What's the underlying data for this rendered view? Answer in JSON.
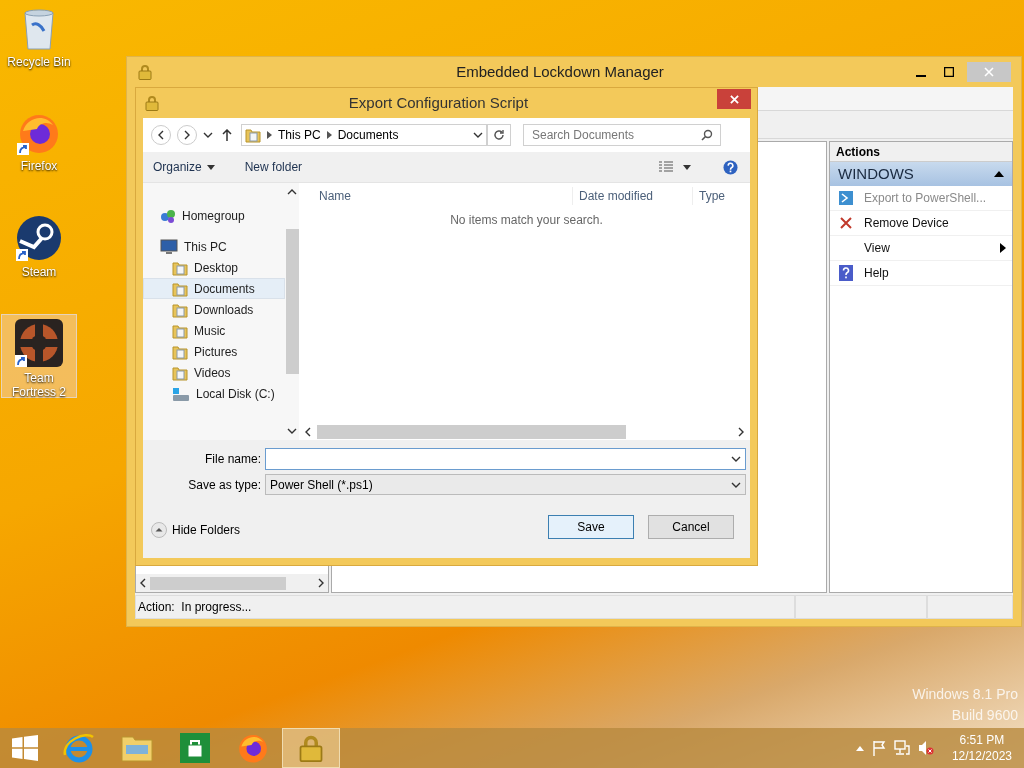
{
  "desktop_icons": [
    {
      "label": "Recycle Bin",
      "kind": "recycle",
      "shortcut": false,
      "selected": false
    },
    {
      "label": "Firefox",
      "kind": "firefox",
      "shortcut": true,
      "selected": false
    },
    {
      "label": "Steam",
      "kind": "steam",
      "shortcut": true,
      "selected": false
    },
    {
      "label": "Team Fortress 2",
      "kind": "game",
      "shortcut": true,
      "selected": true
    }
  ],
  "main_window": {
    "title": "Embedded Lockdown Manager",
    "actions_pane": {
      "header": "Actions",
      "group": {
        "label": "WINDOWS",
        "expanded": true
      },
      "items": [
        {
          "label": "Export to PowerShell...",
          "kind": "script",
          "disabled": true,
          "submenu": false
        },
        {
          "label": "Remove Device",
          "kind": "remove",
          "disabled": false,
          "submenu": false
        },
        {
          "label": "View",
          "kind": "plain",
          "disabled": false,
          "submenu": true
        },
        {
          "label": "Help",
          "kind": "help",
          "disabled": false,
          "submenu": false
        }
      ]
    },
    "status_bar": "Action:  In progress..."
  },
  "dialog": {
    "title": "Export Configuration Script",
    "breadcrumb": [
      "This PC",
      "Documents"
    ],
    "search": {
      "placeholder": "Search Documents"
    },
    "toolbar": {
      "organize": "Organize",
      "new_folder": "New folder"
    },
    "nav_pane": [
      {
        "label": "Homegroup",
        "kind": "group",
        "selected": false
      },
      {
        "label": "This PC",
        "kind": "computer",
        "selected": false,
        "children": [
          {
            "label": "Desktop",
            "kind": "folder",
            "selected": false
          },
          {
            "label": "Documents",
            "kind": "folder",
            "selected": true
          },
          {
            "label": "Downloads",
            "kind": "folder",
            "selected": false
          },
          {
            "label": "Music",
            "kind": "folder",
            "selected": false
          },
          {
            "label": "Pictures",
            "kind": "folder",
            "selected": false
          },
          {
            "label": "Videos",
            "kind": "folder",
            "selected": false
          },
          {
            "label": "Local Disk (C:)",
            "kind": "drive",
            "selected": false
          }
        ]
      }
    ],
    "columns": [
      "Name",
      "Date modified",
      "Type"
    ],
    "empty_message": "No items match your search.",
    "file_name": {
      "label": "File name:"
    },
    "save_as_type": {
      "label": "Save as type:",
      "value": "Power Shell (*.ps1)"
    },
    "hide_folders": "Hide Folders",
    "buttons": [
      {
        "label": "Save",
        "default": true
      },
      {
        "label": "Cancel",
        "default": false
      }
    ]
  },
  "watermark": [
    "Windows 8.1 Pro",
    "Build 9600"
  ],
  "taskbar": {
    "apps": [
      {
        "kind": "browser",
        "selected": false
      },
      {
        "kind": "files",
        "selected": false
      },
      {
        "kind": "store",
        "selected": false
      },
      {
        "kind": "firefox",
        "selected": false
      },
      {
        "kind": "lockdown",
        "selected": true
      }
    ],
    "time": "6:51 PM",
    "date": "12/12/2023"
  }
}
